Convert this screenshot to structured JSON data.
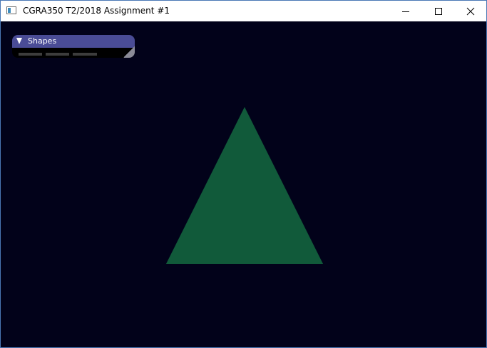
{
  "window": {
    "title": "CGRA350 T2/2018 Assignment #1",
    "icon": "app-window-icon",
    "controls": {
      "minimize_icon": "minimize-icon",
      "maximize_icon": "maximize-icon",
      "close_icon": "close-icon"
    }
  },
  "gui": {
    "panel_title": "Shapes",
    "collapse_icon": "triangle-down-icon",
    "header_color": "#4a4c96"
  },
  "scene": {
    "background_color": "#02021a",
    "shape": "triangle",
    "shape_color": "#115a3a"
  }
}
